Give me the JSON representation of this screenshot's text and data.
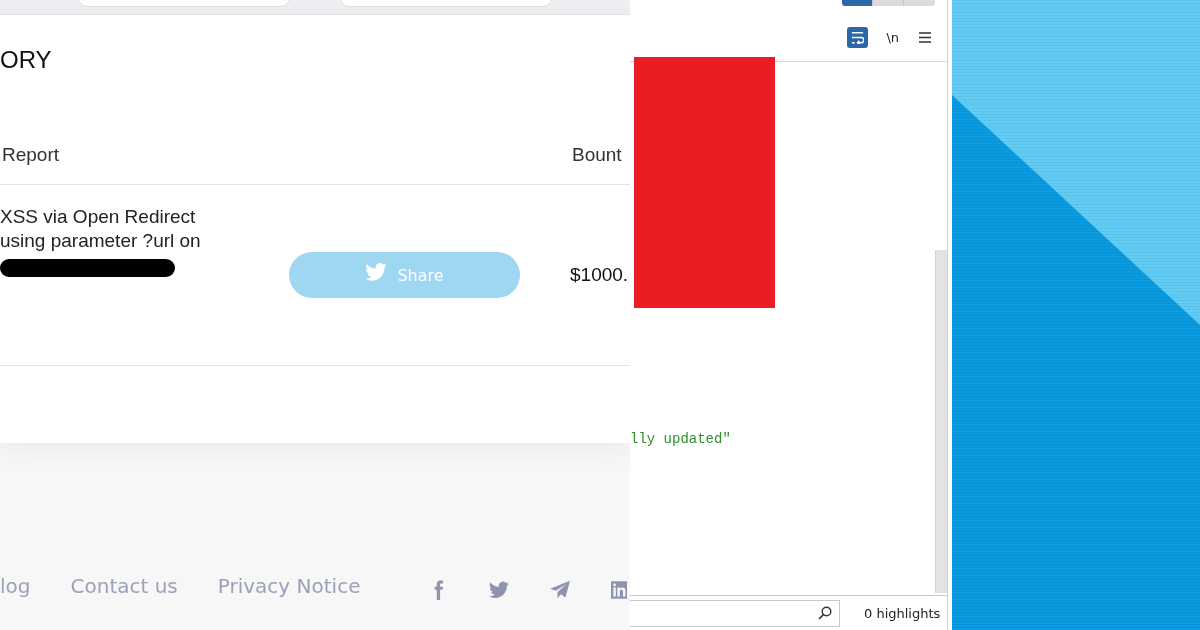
{
  "page": {
    "section_title": "ORY",
    "table": {
      "columns": [
        "Report",
        "Bount"
      ],
      "rows": [
        {
          "report": "XSS via Open Redirect using parameter ?url on",
          "redacted": true,
          "action": "Share",
          "bounty": "$1000."
        }
      ]
    },
    "footer": {
      "links": [
        "log",
        "Contact us",
        "Privacy Notice"
      ]
    }
  },
  "viewer": {
    "view_buttons": [
      {
        "selected": true
      },
      {
        "selected": false
      },
      {
        "selected": false
      }
    ],
    "wrap_toggle": {
      "on": true
    },
    "newline_toggle": "\\n",
    "code_line": "lly updated\"",
    "highlights": "0 highlights"
  }
}
